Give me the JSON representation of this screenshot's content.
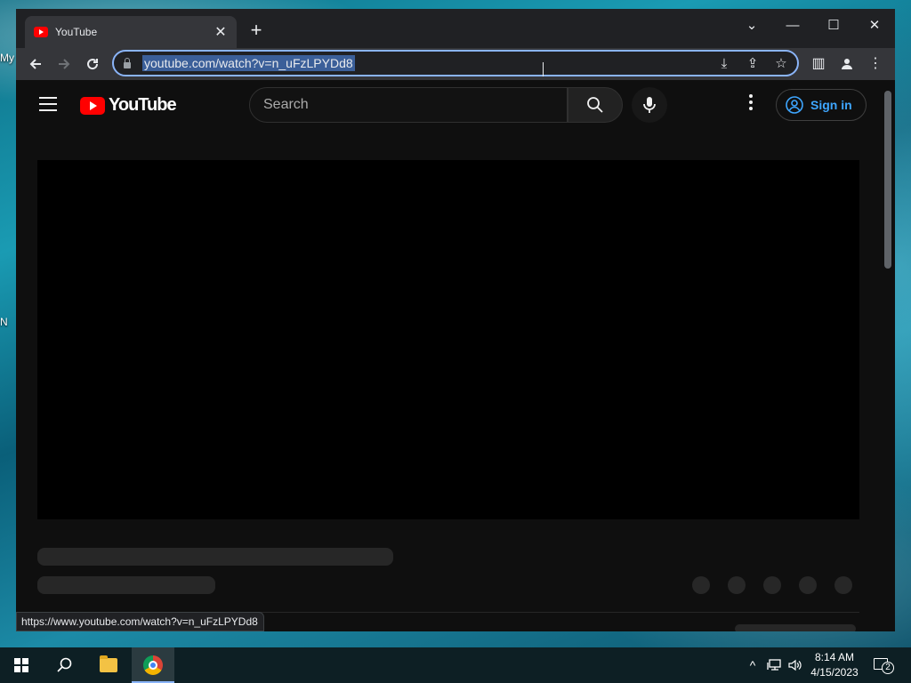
{
  "desktop": {
    "icon_labels": [
      "My",
      "N"
    ]
  },
  "browser": {
    "tab": {
      "title": "YouTube",
      "close_icon": "close-icon"
    },
    "new_tab_icon": "plus-icon",
    "window_controls": {
      "tab_search": "⌄",
      "minimize": "—",
      "maximize": "☐",
      "close": "✕"
    },
    "toolbar": {
      "back_icon": "arrow-left-icon",
      "forward_icon": "arrow-right-icon",
      "reload_icon": "reload-icon",
      "url": "youtube.com/watch?v=n_uFzLPYDd8",
      "install_icon": "install-icon",
      "share_icon": "share-icon",
      "bookmark_icon": "star-icon",
      "side_panel_icon": "side-panel-icon",
      "profile_icon": "person-icon",
      "menu_icon": "kebab-icon"
    },
    "status_url": "https://www.youtube.com/watch?v=n_uFzLPYDd8"
  },
  "youtube": {
    "logo_text": "YouTube",
    "search_placeholder": "Search",
    "sign_in_label": "Sign in"
  },
  "taskbar": {
    "time": "8:14 AM",
    "date": "4/15/2023",
    "notification_count": "2"
  },
  "colors": {
    "accent_blue": "#8ab4f8",
    "youtube_red": "#ff0000",
    "signin_blue": "#3ea6ff",
    "page_bg": "#0f0f0f"
  }
}
